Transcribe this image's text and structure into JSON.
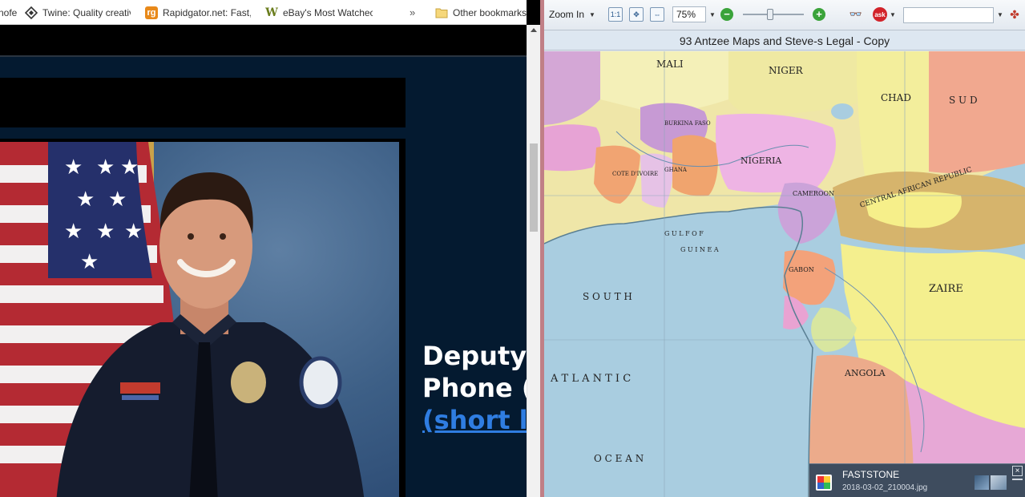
{
  "browser": {
    "bookmarks": [
      {
        "label": "nofe",
        "icon": "partial-bookmark-icon"
      },
      {
        "label": "Twine: Quality creativ",
        "icon": "twine-icon"
      },
      {
        "label": "Rapidgator.net: Fast,",
        "icon": "rapidgator-icon"
      },
      {
        "label": "eBay's Most Watchec",
        "icon": "ebay-w-icon"
      }
    ],
    "more_label": "»",
    "other_bookmarks": "Other bookmarks",
    "page": {
      "line1": "Deputy",
      "line2": "Phone (",
      "link": "(short l"
    }
  },
  "viewer": {
    "toolbar": {
      "zoom_in": "Zoom In",
      "zoom_value": "75%",
      "zoom_level": 0.45
    },
    "doc_title": "93 Antzee Maps and Steve-s Legal - Copy",
    "map_labels": {
      "mali": "MALI",
      "niger": "NIGER",
      "chad": "CHAD",
      "sudan": "S U D",
      "burkina": "BURKINA FASO",
      "nigeria": "NIGERIA",
      "ivory": "COTE D'IVOIRE",
      "ghana": "GHANA",
      "cameroon": "CAMEROON",
      "car": "CENTRAL AFRICAN REPUBLIC",
      "gulf1": "G U L F   O F",
      "gulf2": "G U I N E A",
      "gabon": "GABON",
      "zaire": "ZAIRE",
      "south": "S O U T H",
      "atlantic": "A T L A N T I C",
      "ocean": "O C E A N",
      "angola": "ANGOLA"
    },
    "notification": {
      "app": "FASTSTONE",
      "file": "2018-03-02_210004.jpg"
    }
  },
  "colors": {
    "page_bg": "#041a30",
    "link": "#2f7de1",
    "ocean": "#a9cde0",
    "divider": "#c07f86"
  }
}
